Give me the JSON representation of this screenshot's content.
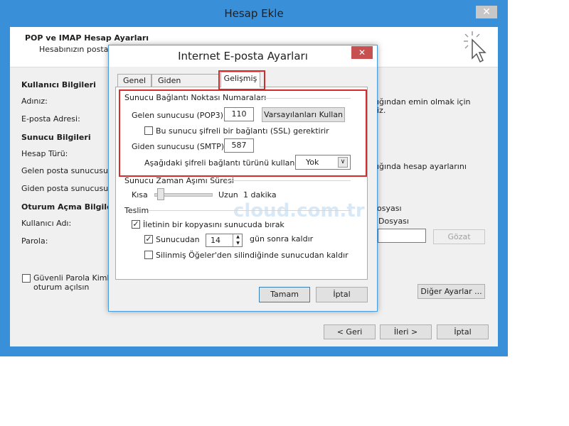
{
  "outer": {
    "title": "Hesap Ekle",
    "close_glyph": "✕",
    "header_title": "POP ve IMAP Hesap Ayarları",
    "header_subtitle": "Hesabınızın posta su",
    "user_section": "Kullanıcı Bilgileri",
    "name_label": "Adınız:",
    "email_label": "E-posta Adresi:",
    "server_section": "Sunucu Bilgileri",
    "account_type_label": "Hesap Türü:",
    "incoming_label": "Gelen posta sunucusu:",
    "outgoing_label": "Giden posta sunucusu (",
    "logon_section": "Oturum Açma Bilgileri",
    "username_label": "Kullanıcı Adı:",
    "password_label": "Parola:",
    "spa_label_1": "Güvenli Parola Kimlik",
    "spa_label_2": "oturum açılsın",
    "right_text_1": "ığından emin olmak için",
    "right_text_2": "iz.",
    "right_text_3": "ığında hesap ayarlarını",
    "right_text_4": "osyası",
    "right_text_5": "Dosyası",
    "browse_button": "Gözat",
    "more_settings_button": "Diğer Ayarlar ...",
    "back_button": "< Geri",
    "next_button": "İleri >",
    "cancel_button": "İptal"
  },
  "dialog": {
    "title": "Internet E-posta Ayarları",
    "close_glyph": "✕",
    "tabs": [
      {
        "label": "Genel"
      },
      {
        "label": "Giden Sunucusu"
      },
      {
        "label": "Gelişmiş"
      }
    ],
    "ports_section": "Sunucu Bağlantı Noktası Numaraları",
    "incoming_label": "Gelen sunucusu (POP3):",
    "incoming_port": "110",
    "defaults_button": "Varsayılanları Kullan",
    "ssl_label": "Bu sunucu şifreli bir bağlantı (SSL) gerektirir",
    "outgoing_label": "Giden sunucusu (SMTP):",
    "outgoing_port": "587",
    "encryption_label": "Aşağıdaki şifreli bağlantı türünü kullan:",
    "encryption_value": "Yok",
    "timeout_section": "Sunucu Zaman Aşımı Süresi",
    "timeout_short": "Kısa",
    "timeout_long": "Uzun",
    "timeout_value": "1 dakika",
    "delivery_section": "Teslim",
    "leave_copy_label": "İletinin bir kopyasını sunucuda bırak",
    "remove_after_label": "Sunucudan",
    "remove_days": "14",
    "remove_after_suffix": "gün sonra kaldır",
    "remove_deleted_label": "Silinmiş Öğeler'den silindiğinde sunucudan kaldır",
    "ok_button": "Tamam",
    "cancel_button": "İptal",
    "watermark": "cloud.com.tr"
  },
  "colors": {
    "window_frame": "#3a8fd9",
    "highlight": "#d22c2c",
    "close_red": "#c75050"
  }
}
